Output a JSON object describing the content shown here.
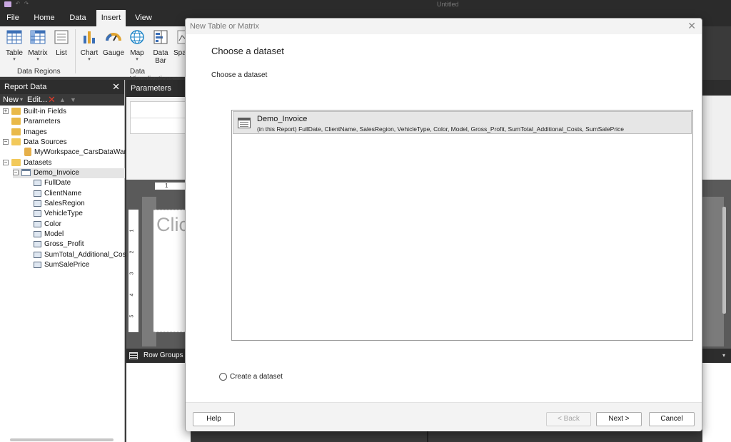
{
  "app": {
    "window_title": "Untitled"
  },
  "ribbon": {
    "tabs": [
      {
        "label": "File"
      },
      {
        "label": "Home"
      },
      {
        "label": "Data"
      },
      {
        "label": "Insert",
        "active": true
      },
      {
        "label": "View"
      }
    ],
    "data_regions": {
      "label": "Data Regions",
      "buttons": [
        "Table",
        "Matrix",
        "List"
      ]
    },
    "data_visualizations": {
      "label": "Data Visualizations",
      "buttons": [
        "Chart",
        "Gauge",
        "Map",
        "Data",
        "Bar",
        "Spa"
      ]
    }
  },
  "report_data": {
    "title": "Report Data",
    "toolbar": {
      "new": "New",
      "edit": "Edit..."
    },
    "tree": {
      "builtin_fields": "Built-in Fields",
      "parameters": "Parameters",
      "images": "Images",
      "data_sources": "Data Sources",
      "data_source_item": "MyWorkspace_CarsDataWarehc",
      "datasets": "Datasets",
      "dataset_item": "Demo_Invoice",
      "fields": [
        "FullDate",
        "ClientName",
        "SalesRegion",
        "VehicleType",
        "Color",
        "Model",
        "Gross_Profit",
        "SumTotal_Additional_Costs",
        "SumSalePrice"
      ]
    }
  },
  "design": {
    "parameters_label": "Parameters",
    "ruler_mark": "1",
    "ruler_left": [
      "1",
      "2",
      "3",
      "4",
      "5"
    ],
    "title_placeholder": "Clic",
    "row_groups": "Row Groups"
  },
  "dialog": {
    "title": "New Table or Matrix",
    "heading": "Choose a dataset",
    "subheading": "Choose a dataset",
    "dataset": {
      "name": "Demo_Invoice",
      "description": "(in this Report) FullDate, ClientName, SalesRegion, VehicleType, Color, Model, Gross_Profit, SumTotal_Additional_Costs, SumSalePrice"
    },
    "create_option": "Create a dataset",
    "buttons": {
      "help": "Help",
      "back": "< Back",
      "next": "Next >",
      "cancel": "Cancel"
    }
  }
}
